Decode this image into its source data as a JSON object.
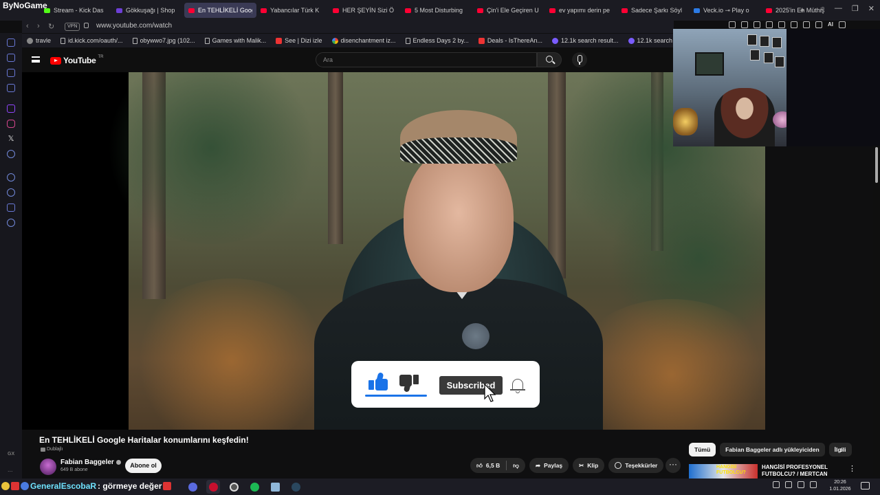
{
  "browser": {
    "brand": "ByNoGame",
    "tabs": [
      {
        "label": "Stream - Kick Das",
        "favicon": "kick-icon"
      },
      {
        "label": "Gökkuşağı | Shop",
        "favicon": "shop-icon"
      },
      {
        "label": "En TEHLİKELİ Google",
        "favicon": "youtube-icon",
        "active": true
      },
      {
        "label": "Yabancılar Türk K",
        "favicon": "youtube-icon"
      },
      {
        "label": "HER ŞEYİN Sizi Ö",
        "favicon": "youtube-icon"
      },
      {
        "label": "5 Most Disturbing",
        "favicon": "youtube-icon"
      },
      {
        "label": "Çin'i Ele Geçiren U",
        "favicon": "youtube-icon"
      },
      {
        "label": "ev yapımı derin pe",
        "favicon": "youtube-icon"
      },
      {
        "label": "Sadece Şarkı Söyl",
        "favicon": "youtube-icon"
      },
      {
        "label": "Veck.io ⊸ Play o",
        "favicon": "veck-icon"
      },
      {
        "label": "2025'in En Müthiş",
        "favicon": "youtube-icon"
      }
    ],
    "new_tab": "+",
    "vpn_label": "VPN",
    "url": "www.youtube.com/watch",
    "ai_label": "AI",
    "bookmarks": [
      {
        "label": "travle",
        "icon": "globe-icon"
      },
      {
        "label": "id.kick.com/oauth/...",
        "icon": "doc-icon"
      },
      {
        "label": "obywwo7.jpg (102...",
        "icon": "doc-icon"
      },
      {
        "label": "Games with Malik...",
        "icon": "doc-icon"
      },
      {
        "label": "See | Dizi izle",
        "icon": "play-icon"
      },
      {
        "label": "disenchantment iz...",
        "icon": "google-icon"
      },
      {
        "label": "Endless Days 2 by...",
        "icon": "doc-icon"
      },
      {
        "label": "Deals - IsThereAn...",
        "icon": "play-icon"
      },
      {
        "label": "12.1k search result...",
        "icon": "perplexity-icon"
      },
      {
        "label": "12.1k search result...",
        "icon": "perplexity-icon"
      }
    ]
  },
  "youtube": {
    "logo_text": "YouTube",
    "country_code": "TR",
    "search_placeholder": "Ara",
    "overlay": {
      "subscribe_label": "Subscribed"
    },
    "video": {
      "title": "En TEHLİKELİ Google Haritalar konumlarını keşfedin!",
      "dubbed_label": "Dublajlı",
      "channel_name": "Fabian Baggeler",
      "subscribers": "649 B abone",
      "subscribe_button": "Abone ol",
      "likes": "6,5 B",
      "share_label": "Paylaş",
      "clip_label": "Klip",
      "thanks_label": "Teşekkürler",
      "more_label": "···"
    },
    "chips": [
      "Tümü",
      "Fabian Baggeler adlı yükleyiciden",
      "İlgili"
    ],
    "recommended": {
      "thumb_text": "HANGİSİ FUTBOLCU?",
      "title": "HANGİSİ PROFESYONEL FUTBOLCU? / MERTCAN"
    }
  },
  "opera_sidebar": {
    "gx_label": "GX",
    "more_label": "..."
  },
  "taskbar": {
    "chat_name": "GeneralEscobaR",
    "chat_message": ": görmeye değer",
    "time": "20:26",
    "date": "1.01.2026"
  }
}
